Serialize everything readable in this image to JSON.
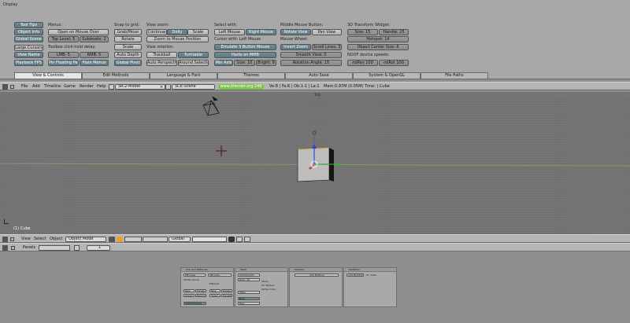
{
  "prefs": {
    "display": {
      "header": "Display",
      "buttons": [
        "Tool Tips",
        "Object Info",
        "Global Scene",
        "Large Cursors",
        "View Name",
        "Playback FPS"
      ]
    },
    "menus": {
      "header": "Menus:",
      "open_on_mouse_over": "Open on Mouse Over",
      "top_level": "Top Level: 5",
      "sublevels": "Sublevels: 2",
      "toolbox_header": "Toolbox click-hold delay:",
      "lmb": "LMB: 5",
      "rmb": "RMB: 5",
      "pin_floating": "Pin Floating Pan",
      "plain_menus": "Plain Menus"
    },
    "snap": {
      "header": "Snap to grid:",
      "buttons": [
        "Grab/Move",
        "Rotate",
        "Scale"
      ],
      "auto_depth": "Auto Depth",
      "global_pivot": "Global Pivot"
    },
    "view_zoom": {
      "header": "View zoom:",
      "continue": "Continue",
      "dolly": "Dolly",
      "scale": "Scale",
      "zoom_to_mouse": "Zoom to Mouse Position",
      "rotation_header": "View rotation:",
      "trackball": "Trackball",
      "turntable": "Turntable",
      "auto_perspective": "Auto Perspective",
      "around_selection": "Around Selection"
    },
    "select_with": {
      "header": "Select with:",
      "left_mouse": "Left Mouse",
      "right_mouse": "Right Mouse",
      "cursor_header": "Cursor with: Left Mouse",
      "emulate_3": "Emulate 3 Button Mouse",
      "paste_mmb": "Paste on MMB",
      "min_axis": "Min Axis",
      "size": "Size: 10",
      "bright": "Bright: 8"
    },
    "middle_mouse": {
      "header": "Middle Mouse Button:",
      "rotate_view": "Rotate View",
      "pan_view": "Pan View",
      "wheel_header": "Mouse Wheel:",
      "invert_zoom": "Invert Zoom",
      "scroll_lines": "Scroll Lines: 3",
      "smooth_view": "Smooth View: 0",
      "rotation_angle": "Rotation Angle: 15"
    },
    "transform_widget": {
      "header": "3D Transform Widget:",
      "size": "Size: 15",
      "handle": "Handle: 25",
      "hotspot": "Hotspot: 14",
      "object_center": "Object Center Size: 6",
      "ndof_header": "NDOF device speeds:",
      "npan": "ndPan 100",
      "nrot": "ndRot 100"
    },
    "tabs": [
      "View & Controls",
      "Edit Methods",
      "Language & Font",
      "Themes",
      "Auto Save",
      "System & OpenGL",
      "File Paths"
    ]
  },
  "info_header": {
    "menus": [
      "File",
      "Add",
      "Timeline",
      "Game",
      "Render",
      "Help"
    ],
    "screen": "SR:2-Model",
    "scene": "SCE:Scene",
    "url": "www.blender.org 249",
    "stats": "Ve:8 | Fa:6 | Ob:1-1 | La:1",
    "mem": "Mem:0.97M (0.05M)",
    "time": "Time: | Cube"
  },
  "viewport": {
    "label": "(1) Cube",
    "view_name": "Top"
  },
  "view3d_header": {
    "menus": [
      "View",
      "Select",
      "Object"
    ],
    "mode": "Object Mode",
    "orientation": "Global"
  },
  "buttons_header": {
    "label": "Panels",
    "frame": "1"
  },
  "panels": {
    "link_materials": {
      "title": "Link and Materials",
      "me": "ME:Cube",
      "ob": "OB:Cube",
      "vertex_group": "Vertex Group",
      "material": "Material",
      "buttons": [
        "New",
        "Delete",
        "Assign",
        "Remove",
        "Select",
        "Deselect",
        "AutoTexSpace"
      ]
    },
    "mesh": {
      "title": "Mesh",
      "autosmooth": "AutoSmooth",
      "degr": "Degr: 30",
      "sticky": "Sticky",
      "uv_texture": "UV Texture",
      "vertex_color": "Vertex Color",
      "make": "Make",
      "new": "New"
    },
    "multires": {
      "title": "Multires",
      "add": "Add Multires"
    },
    "modifiers": {
      "title": "Modifiers",
      "add": "Add Modifier",
      "to": "To: Cube"
    }
  }
}
